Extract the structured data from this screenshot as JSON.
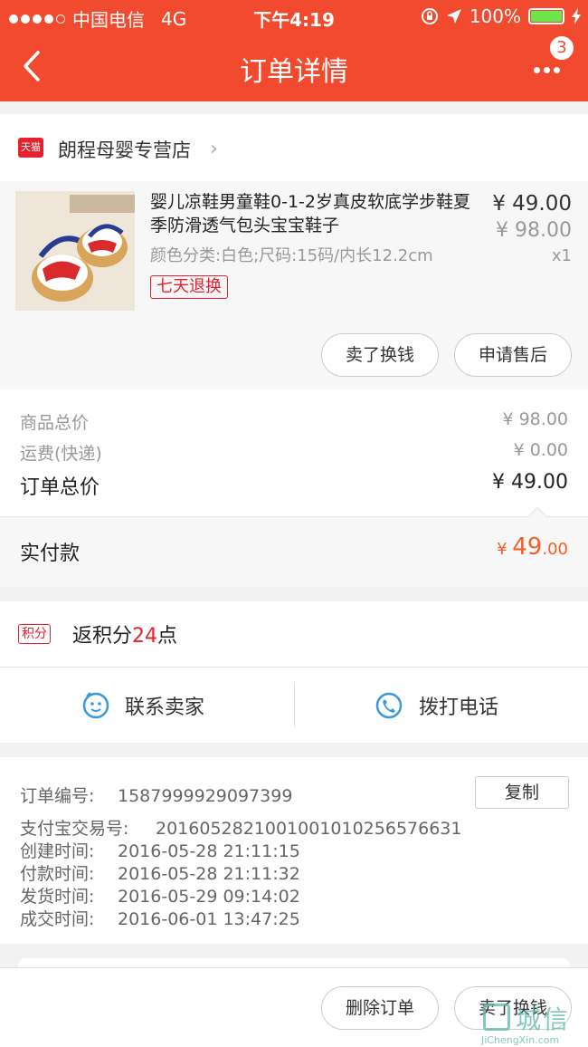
{
  "status_bar": {
    "carrier": "中国电信",
    "network": "4G",
    "time": "下午4:19",
    "battery": "100%",
    "signal_bars_filled": 4,
    "signal_bars_total": 5,
    "accent_color": "#f24a2e",
    "battery_color": "#6fe34a"
  },
  "nav": {
    "title": "订单详情",
    "back_icon": "chevron-left-icon",
    "more_icon": "more-dots-icon",
    "badge_count": "3"
  },
  "shop": {
    "platform_badge": "天猫",
    "name": "朗程母婴专营店"
  },
  "product": {
    "name": "婴儿凉鞋男童鞋0-1-2岁真皮软底学步鞋夏季防滑透气包头宝宝鞋子",
    "spec": "颜色分类:白色;尺码:15码/内长12.2cm",
    "tag": "七天退换",
    "price": "¥ 49.00",
    "original_price": "¥ 98.00",
    "quantity": "x1",
    "buttons": [
      "卖了换钱",
      "申请售后"
    ]
  },
  "summary": {
    "rows": [
      {
        "label": "商品总价",
        "value": "¥ 98.00"
      },
      {
        "label": "运费(快递)",
        "value": "¥ 0.00"
      }
    ],
    "total_label": "订单总价",
    "total_value": "¥ 49.00"
  },
  "paid": {
    "label": "实付款",
    "currency": "¥",
    "integer": "49",
    "decimal": ".00",
    "color": "#f2612a"
  },
  "points": {
    "badge": "积分",
    "prefix": "返积分",
    "number": "24",
    "suffix": "点"
  },
  "contact": {
    "seller_label": "联系卖家",
    "phone_label": "拨打电话",
    "icon_color": "#3a9ad9"
  },
  "order_info": {
    "copy_label": "复制",
    "lines": [
      {
        "label": "订单编号:",
        "value": "1587999929097399"
      },
      {
        "label": "支付宝交易号:",
        "value": "2016052821001001010256576631"
      },
      {
        "label": "创建时间:",
        "value": "2016-05-28 21:11:15"
      },
      {
        "label": "付款时间:",
        "value": "2016-05-28 21:11:32"
      },
      {
        "label": "发货时间:",
        "value": "2016-05-29 09:14:02"
      },
      {
        "label": "成交时间:",
        "value": "2016-06-01 13:47:25"
      }
    ]
  },
  "bottom_bar": {
    "buttons": [
      "删除订单",
      "卖了换钱"
    ]
  },
  "watermark": {
    "cn": "城信",
    "en": "JiChengXin.com"
  }
}
